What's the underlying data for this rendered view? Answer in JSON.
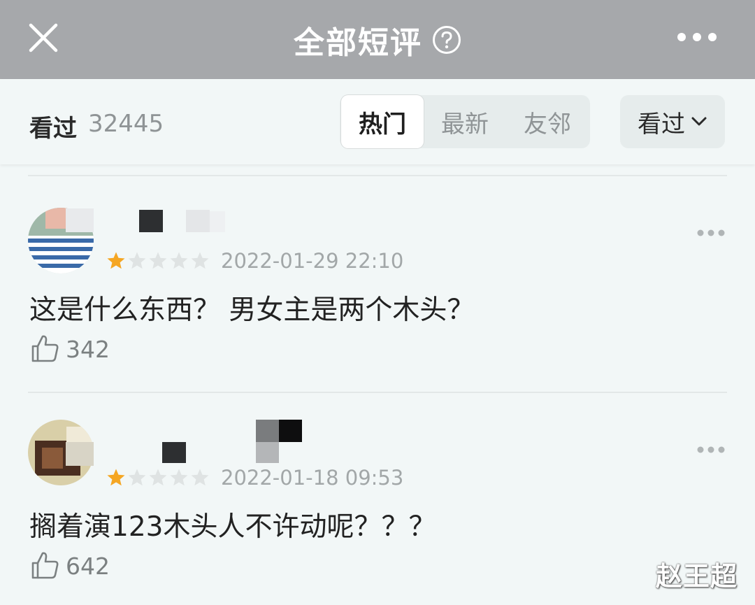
{
  "header": {
    "title": "全部短评",
    "icons": {
      "close": "close-icon",
      "help": "help-circle-icon",
      "more": "more-horizontal-icon"
    }
  },
  "filter": {
    "seen_label": "看过",
    "seen_count": "32445",
    "tabs": [
      {
        "label": "热门",
        "active": true
      },
      {
        "label": "最新",
        "active": false
      },
      {
        "label": "友邻",
        "active": false
      }
    ],
    "dropdown_label": "看过"
  },
  "comments": [
    {
      "rating": 1,
      "date": "2022-01-29 22:10",
      "text": "这是什么东西？ 男女主是两个木头？",
      "likes": "342"
    },
    {
      "rating": 1,
      "date": "2022-01-18 09:53",
      "text": "搁着演123木头人不许动呢？？？",
      "likes": "642"
    }
  ],
  "watermark": "赵王超",
  "colors": {
    "topbar": "#a6a8ab",
    "background": "#f2f7f7",
    "star": "#f5a623",
    "star_empty": "#dfe3e3"
  }
}
